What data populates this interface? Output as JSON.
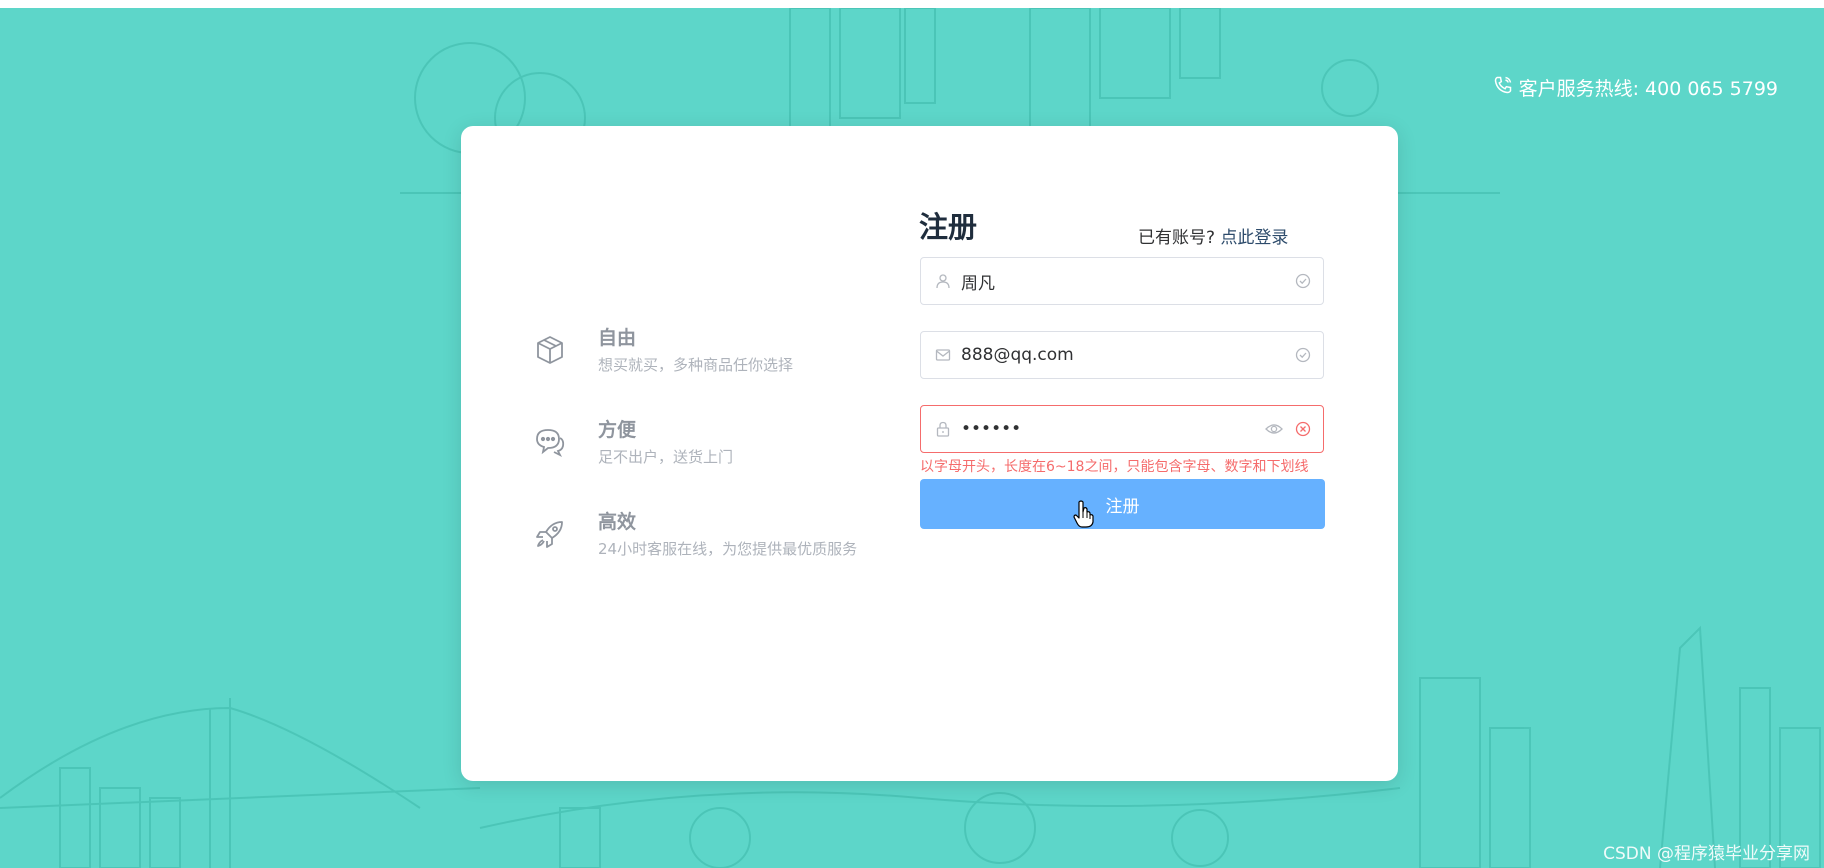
{
  "header": {
    "hotline_text": "客户服务热线: 400 065 5799"
  },
  "features": [
    {
      "title": "自由",
      "desc": "想买就买，多种商品任你选择",
      "icon": "cube-icon"
    },
    {
      "title": "方便",
      "desc": "足不出户，送货上门",
      "icon": "chat-bubbles-icon"
    },
    {
      "title": "高效",
      "desc": "24小时客服在线，为您提供最优质服务",
      "icon": "rocket-icon"
    }
  ],
  "form": {
    "title": "注册",
    "login_prompt": "已有账号?",
    "login_link": "点此登录",
    "username_value": "周凡",
    "email_value": "888@qq.com",
    "password_value": "••••••",
    "password_error": "以字母开头，长度在6~18之间，只能包含字母、数字和下划线",
    "submit_label": "注册"
  },
  "watermark": "CSDN @程序猿毕业分享网",
  "colors": {
    "background": "#5dd6c9",
    "primary_button": "#66b1ff",
    "error": "#f56c6c",
    "link": "#2d4b6b"
  }
}
